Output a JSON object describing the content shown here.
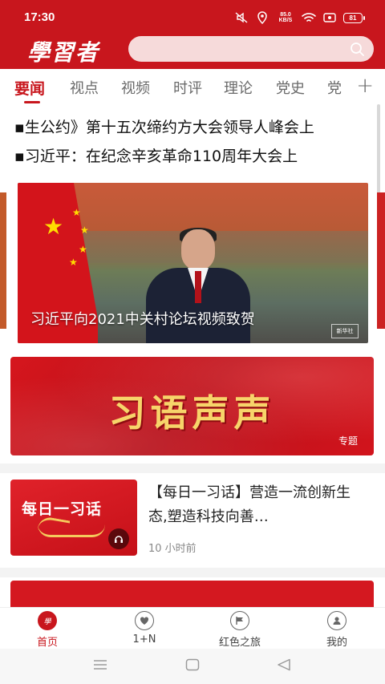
{
  "status_bar": {
    "time": "17:30",
    "speed_value": "85.0",
    "speed_unit": "KB/S",
    "battery": "81",
    "icons": [
      "mute-icon",
      "location-icon",
      "wifi-icon",
      "record-icon"
    ]
  },
  "header": {
    "logo": "學習者",
    "search_icon": "search-icon"
  },
  "tabs": {
    "items": [
      "要闻",
      "视点",
      "视频",
      "时评",
      "理论",
      "党史",
      "党"
    ],
    "active_index": 0,
    "more_icon": "+"
  },
  "headlines": [
    "▪生公约》第十五次缔约方大会领导人峰会上",
    "▪习近平：在纪念辛亥革命110周年大会上"
  ],
  "banner": {
    "caption": "习近平向2021中关村论坛视频致贺",
    "badge": "新华社"
  },
  "special": {
    "title": "习语声声",
    "tag": "专题"
  },
  "news_item": {
    "thumb_title": "每日一习话",
    "title": "【每日一习话】营造一流创新生态,塑造科技向善…",
    "time": "10 小时前"
  },
  "bottom_nav": [
    {
      "label": "首页",
      "icon": "home-logo-icon",
      "active": true
    },
    {
      "label": "1+N",
      "icon": "heart-icon",
      "active": false
    },
    {
      "label": "红色之旅",
      "icon": "flag-icon",
      "active": false
    },
    {
      "label": "我的",
      "icon": "user-icon",
      "active": false
    }
  ],
  "colors": {
    "brand_red": "#c8161d",
    "search_bg": "#f6dada",
    "gold_text": "#f7d46a"
  }
}
